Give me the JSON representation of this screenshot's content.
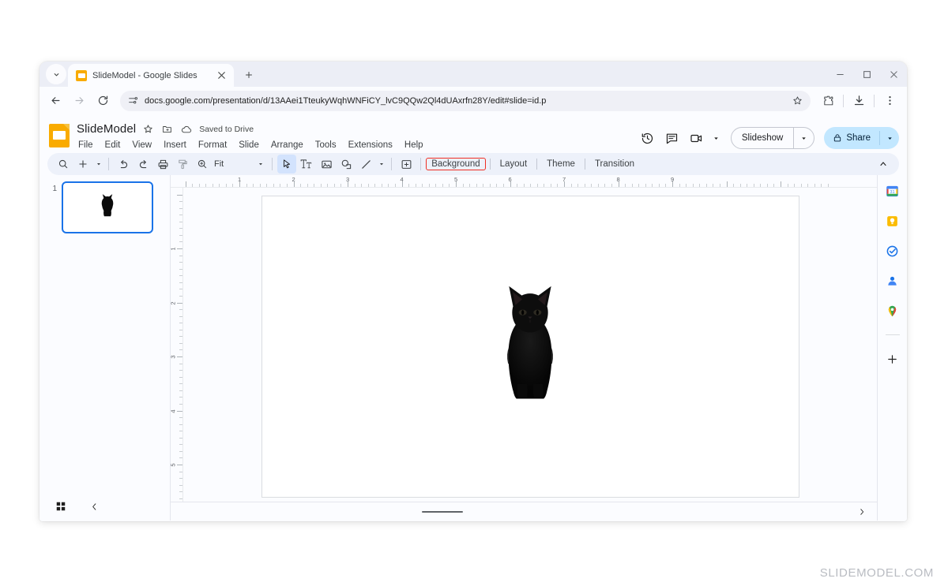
{
  "browser": {
    "tab": {
      "title": "SlideModel - Google Slides",
      "favicon": "slides-favicon",
      "close": "×"
    },
    "new_tab_label": "+",
    "window_controls": {
      "minimize": "–",
      "maximize": "□",
      "close": "✕"
    },
    "address": "docs.google.com/presentation/d/13AAei1TteukyWqhWNFiCY_lvC9QQw2Ql4dUAxrfn28Y/edit#slide=id.p",
    "nav": {
      "back": "←",
      "forward": "→",
      "reload": "⟳"
    }
  },
  "app": {
    "doc_title": "SlideModel",
    "save_status": "Saved to Drive",
    "menus": [
      "File",
      "Edit",
      "View",
      "Insert",
      "Format",
      "Slide",
      "Arrange",
      "Tools",
      "Extensions",
      "Help"
    ],
    "header_actions": {
      "version_history": "version-history-icon",
      "comments": "comment-icon",
      "meet": "meet-icon",
      "slideshow_label": "Slideshow",
      "share_label": "Share"
    },
    "toolbar": {
      "search": "search-icon",
      "new_slide": "+",
      "undo": "undo-icon",
      "redo": "redo-icon",
      "print": "print-icon",
      "paint_format": "paint-format-icon",
      "zoom": "zoom-icon",
      "zoom_value": "Fit",
      "select": "cursor-icon",
      "text_box": "Tт",
      "image": "image-icon",
      "shape": "shape-icon",
      "line": "line-icon",
      "comment": "add-comment-icon",
      "buttons": [
        "Background",
        "Layout",
        "Theme",
        "Transition"
      ],
      "highlighted_button": "Background",
      "collapse": "collapse-toolbar-icon"
    },
    "filmstrip": {
      "slide_number": "1",
      "grid_view": "grid-view-icon",
      "collapse": "‹"
    },
    "rulers": {
      "horizontal": [
        "1",
        "2",
        "3",
        "4",
        "5",
        "6",
        "7",
        "8",
        "9"
      ],
      "vertical": [
        "1",
        "2",
        "3",
        "4",
        "5"
      ]
    },
    "canvas": {
      "slide_content": "black-kitten-image",
      "notes_handle": "speaker-notes-handle",
      "expand": "›"
    },
    "side_rail": [
      {
        "name": "google-calendar-icon"
      },
      {
        "name": "google-keep-icon"
      },
      {
        "name": "google-tasks-icon"
      },
      {
        "name": "google-contacts-icon"
      },
      {
        "name": "google-maps-icon"
      },
      {
        "name": "add-ons-plus-icon"
      }
    ]
  },
  "watermark": "SLIDEMODEL.COM",
  "colors": {
    "accent_blue": "#1a73e8",
    "slides_yellow": "#f9ab00",
    "share_blue": "#c2e7ff",
    "highlight_red": "#ef2f24",
    "chrome_bg": "#eceef6"
  }
}
